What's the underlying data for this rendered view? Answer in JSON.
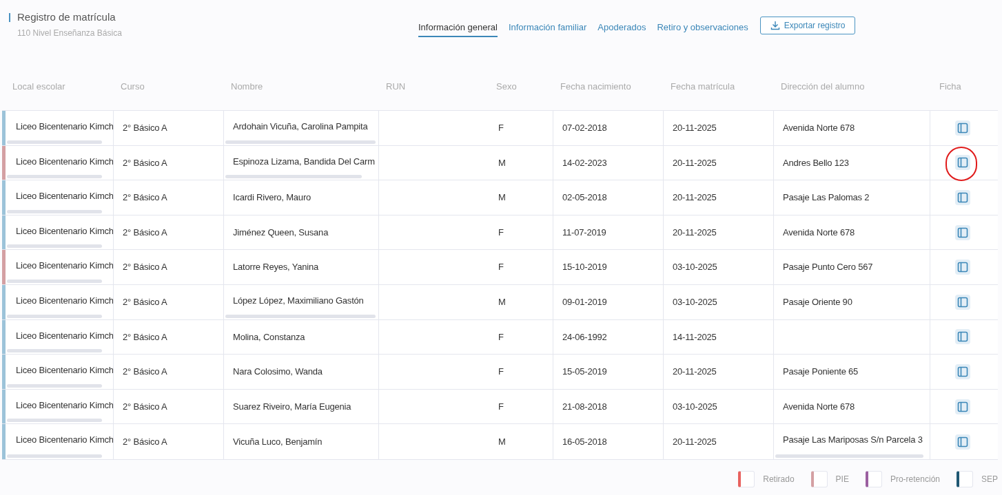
{
  "header": {
    "title": "Registro de matrícula",
    "subtitle": "110 Nivel Enseñanza Básica"
  },
  "tabs": [
    {
      "label": "Información general",
      "selected": true
    },
    {
      "label": "Información familiar",
      "selected": false
    },
    {
      "label": "Apoderados",
      "selected": false
    },
    {
      "label": "Retiro y observaciones",
      "selected": false
    }
  ],
  "export_button": "Exportar registro",
  "table": {
    "columns": [
      "Local escolar",
      "Curso",
      "Nombre",
      "RUN",
      "Sexo",
      "Fecha nacimiento",
      "Fecha matrícula",
      "Dirección del alumno",
      "Ficha"
    ],
    "rows": [
      {
        "color": "#9cc3d9",
        "local": "Liceo Bicentenario Kimch",
        "curso": "2° Básico A",
        "nombre": "Ardohain Vicuña, Carolina Pampita",
        "name_scrolls": true,
        "sexo": "F",
        "nacimiento": "07-02-2018",
        "matricula": "20-11-2025",
        "direccion": "Avenida Norte 678",
        "address_scrolls": false,
        "circled": false
      },
      {
        "color": "#d4a0a3",
        "local": "Liceo Bicentenario Kimch",
        "curso": "2° Básico A",
        "nombre": "Espinoza Lizama, Bandida Del Carm",
        "name_scrolls": true,
        "sexo": "M",
        "nacimiento": "14-02-2023",
        "matricula": "20-11-2025",
        "direccion": "Andres Bello 123",
        "address_scrolls": false,
        "circled": true
      },
      {
        "color": "#9cc3d9",
        "local": "Liceo Bicentenario Kimch",
        "curso": "2° Básico A",
        "nombre": "Icardi Rivero, Mauro",
        "name_scrolls": false,
        "sexo": "M",
        "nacimiento": "02-05-2018",
        "matricula": "20-11-2025",
        "direccion": "Pasaje Las Palomas 2",
        "address_scrolls": false,
        "circled": false
      },
      {
        "color": "#9cc3d9",
        "local": "Liceo Bicentenario Kimch",
        "curso": "2° Básico A",
        "nombre": "Jiménez Queen, Susana",
        "name_scrolls": false,
        "sexo": "F",
        "nacimiento": "11-07-2019",
        "matricula": "20-11-2025",
        "direccion": "Avenida Norte 678",
        "address_scrolls": false,
        "circled": false
      },
      {
        "color": "#d4a0a3",
        "local": "Liceo Bicentenario Kimch",
        "curso": "2° Básico A",
        "nombre": "Latorre Reyes, Yanina",
        "name_scrolls": false,
        "sexo": "F",
        "nacimiento": "15-10-2019",
        "matricula": "03-10-2025",
        "direccion": "Pasaje Punto Cero 567",
        "address_scrolls": false,
        "circled": false
      },
      {
        "color": "#9cc3d9",
        "local": "Liceo Bicentenario Kimch",
        "curso": "2° Básico A",
        "nombre": "López López, Maximiliano Gastón",
        "name_scrolls": true,
        "sexo": "M",
        "nacimiento": "09-01-2019",
        "matricula": "03-10-2025",
        "direccion": "Pasaje Oriente 90",
        "address_scrolls": false,
        "circled": false
      },
      {
        "color": "#9cc3d9",
        "local": "Liceo Bicentenario Kimch",
        "curso": "2° Básico A",
        "nombre": "Molina, Constanza",
        "name_scrolls": false,
        "sexo": "F",
        "nacimiento": "24-06-1992",
        "matricula": "14-11-2025",
        "address_scrolls": false,
        "circled": false
      },
      {
        "color": "#9cc3d9",
        "local": "Liceo Bicentenario Kimch",
        "curso": "2° Básico A",
        "nombre": "Nara Colosimo, Wanda",
        "name_scrolls": false,
        "sexo": "F",
        "nacimiento": "15-05-2019",
        "matricula": "20-11-2025",
        "direccion": "Pasaje Poniente 65",
        "address_scrolls": false,
        "circled": false
      },
      {
        "color": "#9cc3d9",
        "local": "Liceo Bicentenario Kimch",
        "curso": "2° Básico A",
        "nombre": "Suarez Riveiro, María Eugenia",
        "name_scrolls": false,
        "sexo": "F",
        "nacimiento": "21-08-2018",
        "matricula": "03-10-2025",
        "direccion": "Avenida Norte 678",
        "address_scrolls": false,
        "circled": false
      },
      {
        "color": "#9cc3d9",
        "local": "Liceo Bicentenario Kimch",
        "curso": "2° Básico A",
        "nombre": "Vicuña Luco, Benjamín",
        "name_scrolls": false,
        "sexo": "M",
        "nacimiento": "16-05-2018",
        "matricula": "20-11-2025",
        "direccion": "Pasaje Las Mariposas S/n Parcela 3",
        "address_scrolls": true,
        "circled": false
      }
    ]
  },
  "legend": [
    {
      "label": "Retirado",
      "color": "#e8625f"
    },
    {
      "label": "PIE",
      "color": "#d4a0a3"
    },
    {
      "label": "Pro-retención",
      "color": "#9b5fa0"
    },
    {
      "label": "SEP",
      "color": "#1f5873"
    }
  ]
}
